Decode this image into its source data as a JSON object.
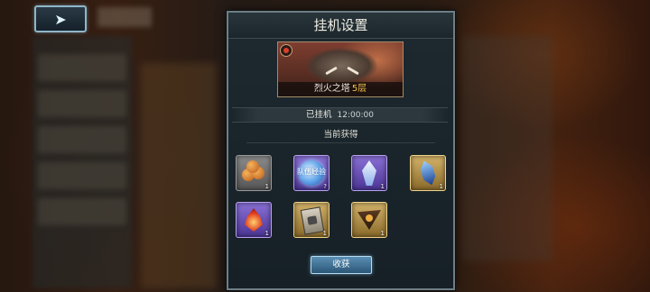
{
  "back_button": {
    "icon": "back-arrow-icon"
  },
  "dialog": {
    "title": "挂机设置",
    "stage": {
      "name": "烈火之塔",
      "floor": "5层",
      "badge_icon": "stage-badge-icon"
    },
    "status": {
      "label": "已挂机",
      "time": "12:00:00"
    },
    "rewards_title": "当前获得",
    "items": [
      {
        "name": "food-item",
        "rarity": "gray",
        "count": "1"
      },
      {
        "name": "team-exp-item",
        "rarity": "purple",
        "text": "队伍经验",
        "count": "?"
      },
      {
        "name": "crystal-item",
        "rarity": "purple",
        "count": "1"
      },
      {
        "name": "blue-gem-item",
        "rarity": "gold",
        "count": "1"
      },
      {
        "name": "fire-item",
        "rarity": "purple",
        "count": "1"
      },
      {
        "name": "card-item",
        "rarity": "gold",
        "count": "1"
      },
      {
        "name": "triangle-item",
        "rarity": "gold",
        "count": "1"
      }
    ],
    "claim_button": "收获"
  }
}
